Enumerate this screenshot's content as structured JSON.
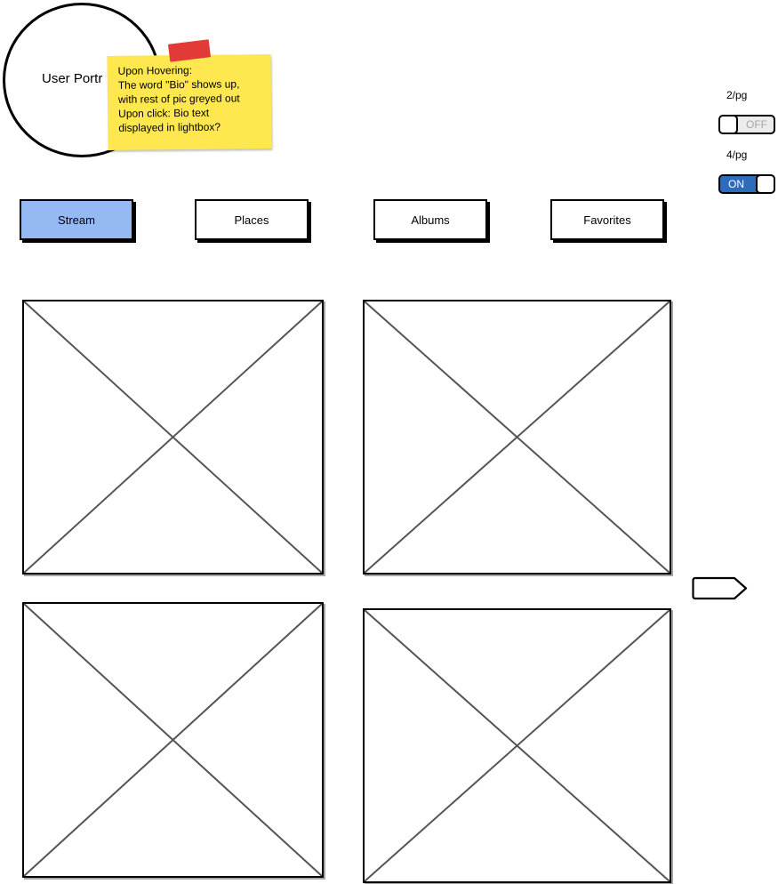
{
  "portrait": {
    "label": "User Portr"
  },
  "sticky_note": {
    "lines": [
      "Upon Hovering:",
      "The word \"Bio\" shows up,",
      "with rest of pic greyed out",
      "Upon click: Bio text",
      "displayed in lightbox?"
    ]
  },
  "toggles": [
    {
      "label": "2/pg",
      "state_text": "OFF",
      "on": false
    },
    {
      "label": "4/pg",
      "state_text": "ON",
      "on": true
    }
  ],
  "tabs": [
    {
      "label": "Stream",
      "active": true
    },
    {
      "label": "Places",
      "active": false
    },
    {
      "label": "Albums",
      "active": false
    },
    {
      "label": "Favorites",
      "active": false
    }
  ],
  "images": [
    {
      "icon": "image-placeholder-icon"
    },
    {
      "icon": "image-placeholder-icon"
    },
    {
      "icon": "image-placeholder-icon"
    },
    {
      "icon": "image-placeholder-icon"
    }
  ],
  "next_button": {
    "icon": "arrow-right-icon"
  },
  "colors": {
    "active_tab": "#94b9f3",
    "toggle_on": "#2d6cbb",
    "sticky": "#ffe84f",
    "tape": "#e23a36"
  }
}
